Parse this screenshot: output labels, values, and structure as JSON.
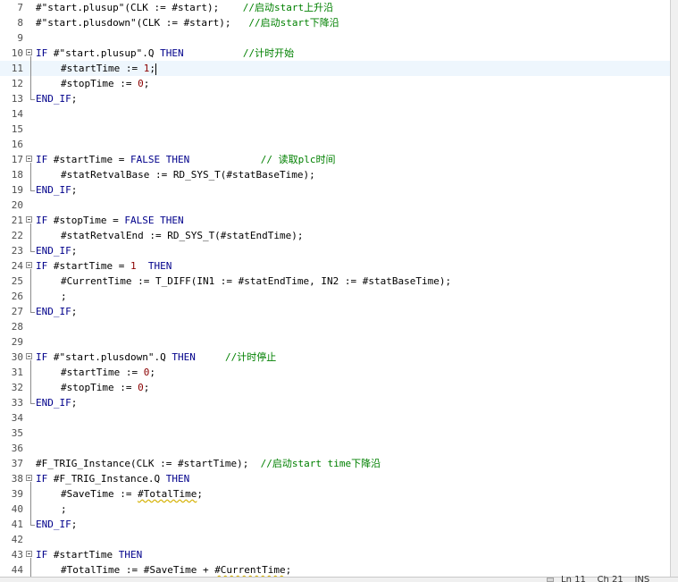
{
  "editor": {
    "caret_line": 11,
    "lines": [
      {
        "n": "7",
        "fold": false,
        "indent": 0,
        "parts": [
          [
            "op",
            "#\"start.plusup\"(CLK := #start);    "
          ],
          [
            "cm",
            "//启动start上升沿"
          ]
        ]
      },
      {
        "n": "8",
        "fold": false,
        "indent": 0,
        "parts": [
          [
            "op",
            "#\"start.plusdown\"(CLK := #start);   "
          ],
          [
            "cm",
            "//启动start下降沿"
          ]
        ]
      },
      {
        "n": "9",
        "fold": false,
        "indent": 0,
        "parts": []
      },
      {
        "n": "10",
        "fold": true,
        "indent": 0,
        "parts": [
          [
            "kw",
            "IF"
          ],
          [
            "op",
            " #\"start.plusup\".Q "
          ],
          [
            "kw",
            "THEN"
          ],
          [
            "op",
            "          "
          ],
          [
            "cm",
            "//计时开始"
          ]
        ]
      },
      {
        "n": "11",
        "fold": false,
        "indent": 1,
        "parts": [
          [
            "op",
            "#startTime := "
          ],
          [
            "nm",
            "1"
          ],
          [
            "op",
            ";"
          ]
        ]
      },
      {
        "n": "12",
        "fold": false,
        "indent": 1,
        "parts": [
          [
            "op",
            "#stopTime := "
          ],
          [
            "nm",
            "0"
          ],
          [
            "op",
            ";"
          ]
        ]
      },
      {
        "n": "13",
        "fold": false,
        "indent": 0,
        "parts": [
          [
            "kw",
            "END_IF"
          ],
          [
            "op",
            ";"
          ]
        ]
      },
      {
        "n": "14",
        "fold": false,
        "indent": 0,
        "parts": []
      },
      {
        "n": "15",
        "fold": false,
        "indent": 0,
        "parts": []
      },
      {
        "n": "16",
        "fold": false,
        "indent": 0,
        "parts": []
      },
      {
        "n": "17",
        "fold": true,
        "indent": 0,
        "parts": [
          [
            "kw",
            "IF"
          ],
          [
            "op",
            " #startTime = "
          ],
          [
            "kw",
            "FALSE"
          ],
          [
            "op",
            " "
          ],
          [
            "kw",
            "THEN"
          ],
          [
            "op",
            "            "
          ],
          [
            "cm",
            "// 读取plc时间"
          ]
        ]
      },
      {
        "n": "18",
        "fold": false,
        "indent": 1,
        "parts": [
          [
            "op",
            "#statRetvalBase := RD_SYS_T(#statBaseTime);"
          ]
        ]
      },
      {
        "n": "19",
        "fold": false,
        "indent": 0,
        "parts": [
          [
            "kw",
            "END_IF"
          ],
          [
            "op",
            ";"
          ]
        ]
      },
      {
        "n": "20",
        "fold": false,
        "indent": 0,
        "parts": []
      },
      {
        "n": "21",
        "fold": true,
        "indent": 0,
        "parts": [
          [
            "kw",
            "IF"
          ],
          [
            "op",
            " #stopTime = "
          ],
          [
            "kw",
            "FALSE"
          ],
          [
            "op",
            " "
          ],
          [
            "kw",
            "THEN"
          ]
        ]
      },
      {
        "n": "22",
        "fold": false,
        "indent": 1,
        "parts": [
          [
            "op",
            "#statRetvalEnd := RD_SYS_T(#statEndTime);"
          ]
        ]
      },
      {
        "n": "23",
        "fold": false,
        "indent": 0,
        "parts": [
          [
            "kw",
            "END_IF"
          ],
          [
            "op",
            ";"
          ]
        ]
      },
      {
        "n": "24",
        "fold": true,
        "indent": 0,
        "parts": [
          [
            "kw",
            "IF"
          ],
          [
            "op",
            " #startTime = "
          ],
          [
            "nm",
            "1"
          ],
          [
            "op",
            "  "
          ],
          [
            "kw",
            "THEN"
          ]
        ]
      },
      {
        "n": "25",
        "fold": false,
        "indent": 1,
        "parts": [
          [
            "op",
            "#CurrentTime := T_DIFF(IN1 := #statEndTime, IN2 := #statBaseTime);"
          ]
        ]
      },
      {
        "n": "26",
        "fold": false,
        "indent": 1,
        "parts": [
          [
            "op",
            ";"
          ]
        ]
      },
      {
        "n": "27",
        "fold": false,
        "indent": 0,
        "parts": [
          [
            "kw",
            "END_IF"
          ],
          [
            "op",
            ";"
          ]
        ]
      },
      {
        "n": "28",
        "fold": false,
        "indent": 0,
        "parts": []
      },
      {
        "n": "29",
        "fold": false,
        "indent": 0,
        "parts": []
      },
      {
        "n": "30",
        "fold": true,
        "indent": 0,
        "parts": [
          [
            "kw",
            "IF"
          ],
          [
            "op",
            " #\"start.plusdown\".Q "
          ],
          [
            "kw",
            "THEN"
          ],
          [
            "op",
            "     "
          ],
          [
            "cm",
            "//计时停止"
          ]
        ]
      },
      {
        "n": "31",
        "fold": false,
        "indent": 1,
        "parts": [
          [
            "op",
            "#startTime := "
          ],
          [
            "nm",
            "0"
          ],
          [
            "op",
            ";"
          ]
        ]
      },
      {
        "n": "32",
        "fold": false,
        "indent": 1,
        "parts": [
          [
            "op",
            "#stopTime := "
          ],
          [
            "nm",
            "0"
          ],
          [
            "op",
            ";"
          ]
        ]
      },
      {
        "n": "33",
        "fold": false,
        "indent": 0,
        "parts": [
          [
            "kw",
            "END_IF"
          ],
          [
            "op",
            ";"
          ]
        ]
      },
      {
        "n": "34",
        "fold": false,
        "indent": 0,
        "parts": []
      },
      {
        "n": "35",
        "fold": false,
        "indent": 0,
        "parts": []
      },
      {
        "n": "36",
        "fold": false,
        "indent": 0,
        "parts": []
      },
      {
        "n": "37",
        "fold": false,
        "indent": 0,
        "parts": [
          [
            "op",
            "#F_TRIG_Instance(CLK := #startTime);  "
          ],
          [
            "cm",
            "//启动start time下降沿"
          ]
        ]
      },
      {
        "n": "38",
        "fold": true,
        "indent": 0,
        "parts": [
          [
            "kw",
            "IF"
          ],
          [
            "op",
            " #F_TRIG_Instance.Q "
          ],
          [
            "kw",
            "THEN"
          ]
        ]
      },
      {
        "n": "39",
        "fold": false,
        "indent": 1,
        "parts": [
          [
            "op",
            "#SaveTime := "
          ],
          [
            "sq",
            "#TotalTime"
          ],
          [
            "op",
            ";"
          ]
        ]
      },
      {
        "n": "40",
        "fold": false,
        "indent": 1,
        "parts": [
          [
            "op",
            ";"
          ]
        ]
      },
      {
        "n": "41",
        "fold": false,
        "indent": 0,
        "parts": [
          [
            "kw",
            "END_IF"
          ],
          [
            "op",
            ";"
          ]
        ]
      },
      {
        "n": "42",
        "fold": false,
        "indent": 0,
        "parts": []
      },
      {
        "n": "43",
        "fold": true,
        "indent": 0,
        "parts": [
          [
            "kw",
            "IF"
          ],
          [
            "op",
            " #startTime "
          ],
          [
            "kw",
            "THEN"
          ]
        ]
      },
      {
        "n": "44",
        "fold": false,
        "indent": 1,
        "parts": [
          [
            "op",
            "#TotalTime := #SaveTime + "
          ],
          [
            "sq",
            "#CurrentTime"
          ],
          [
            "op",
            ";"
          ]
        ]
      }
    ]
  },
  "status": {
    "text": "Ln 11    Ch 21    INS"
  }
}
